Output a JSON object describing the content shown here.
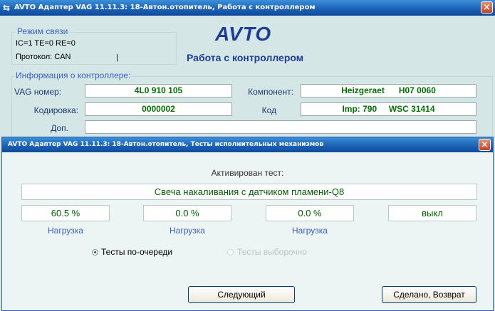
{
  "main_window": {
    "title": "AVTO Адаптер VAG 11.11.3: 18-Автон.отопитель,  Работа с контроллером",
    "close_label": "×"
  },
  "connection": {
    "group_label": "Режим связи",
    "counters": "IC=1  TE=0  RE=0",
    "protocol": "Протокол: CAN",
    "cursor_mark": "|"
  },
  "branding": {
    "logo": "AVTO",
    "subtitle": "Работа с контроллером"
  },
  "controller_info": {
    "group_label": "Информация о контроллере:",
    "vag_label": "VAG номер:",
    "vag_value": "4L0 910 105",
    "component_label": "Компонент:",
    "component_value": "Heizgeraet      H07 0060",
    "coding_label": "Кодировка:",
    "coding_value": "0000002",
    "code_label": "Код",
    "code_value": "Imp: 790     WSC 31414",
    "extra_label": "Доп.",
    "extra_value": ""
  },
  "dialog": {
    "title": "AVTO Адаптер VAG 11.11.3: 18-Автон.отопитель,  Тесты исполнительных механизмов",
    "close_label": "×",
    "active_test_label": "Активирован тест:",
    "active_test_value": "Свеча накаливания с датчиком пламени-Q8",
    "values": [
      "60.5 %",
      "0.0 %",
      "0.0 %",
      "выкл"
    ],
    "load_labels": [
      "Нагрузка",
      "Нагрузка",
      "Нагрузка"
    ],
    "radio_sequential": "Тесты по-очереди",
    "radio_selective": "Тесты выборочно",
    "next_button": "Следующий",
    "done_button": "Сделано, Возврат"
  }
}
